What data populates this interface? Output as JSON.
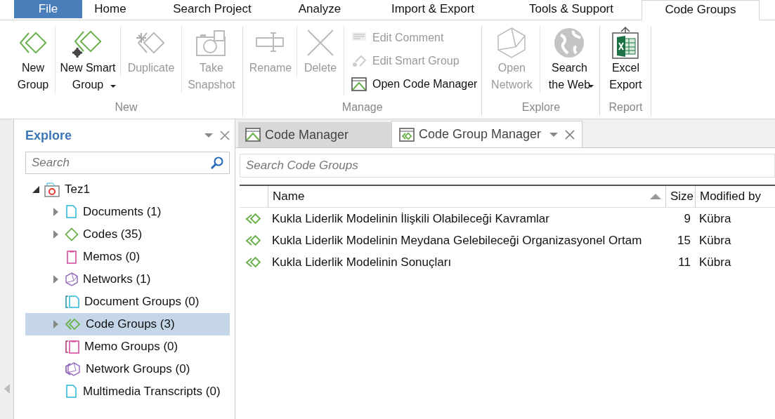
{
  "menu_tabs": [
    {
      "label": "File",
      "kind": "file",
      "selected": false
    },
    {
      "label": "Home",
      "kind": "tab",
      "selected": false
    },
    {
      "label": "Search Project",
      "kind": "tab",
      "selected": false
    },
    {
      "label": "Analyze",
      "kind": "tab",
      "selected": false
    },
    {
      "label": "Import & Export",
      "kind": "tab",
      "selected": false
    },
    {
      "label": "Tools & Support",
      "kind": "tab",
      "selected": false
    },
    {
      "label": "Code Groups",
      "kind": "tab",
      "selected": true
    }
  ],
  "ribbon": {
    "groups": [
      {
        "label": "New",
        "buttons": [
          {
            "kind": "large",
            "label": "New Group",
            "disabled": false,
            "dropdown": false
          },
          {
            "kind": "large",
            "label": "New Smart Group",
            "disabled": false,
            "dropdown": true
          },
          {
            "kind": "large",
            "label": "Duplicate",
            "disabled": true,
            "dropdown": false
          },
          {
            "kind": "large",
            "label": "Take Snapshot",
            "disabled": true,
            "dropdown": false
          }
        ]
      },
      {
        "label": "Manage",
        "buttons": [
          {
            "kind": "large",
            "label": "Rename",
            "disabled": true,
            "dropdown": false
          },
          {
            "kind": "large",
            "label": "Delete",
            "disabled": true,
            "dropdown": false
          },
          {
            "kind": "small",
            "label": "Edit Comment",
            "disabled": true
          },
          {
            "kind": "small",
            "label": "Edit Smart Group",
            "disabled": true
          },
          {
            "kind": "small",
            "label": "Open Code Manager",
            "disabled": false
          }
        ]
      },
      {
        "label": "Explore",
        "buttons": [
          {
            "kind": "large",
            "label": "Open Network",
            "disabled": true,
            "dropdown": false
          },
          {
            "kind": "large",
            "label": "Search the Web",
            "disabled": false,
            "dropdown": true
          }
        ]
      },
      {
        "label": "Report",
        "buttons": [
          {
            "kind": "large",
            "label": "Excel Export",
            "disabled": false,
            "dropdown": false
          }
        ]
      }
    ]
  },
  "explore": {
    "title": "Explore",
    "search": {
      "placeholder": "Search"
    },
    "tree": {
      "label": "Tez1",
      "expanded": true,
      "children": [
        {
          "label": "Documents (1)",
          "expanded": false,
          "selected": false
        },
        {
          "label": "Codes (35)",
          "expanded": false,
          "selected": false
        },
        {
          "label": "Memos (0)",
          "selected": false
        },
        {
          "label": "Networks (1)",
          "expanded": false,
          "selected": false
        },
        {
          "label": "Document Groups (0)",
          "selected": false
        },
        {
          "label": "Code Groups (3)",
          "expanded": false,
          "selected": true
        },
        {
          "label": "Memo Groups (0)",
          "selected": false
        },
        {
          "label": "Network Groups (0)",
          "selected": false
        },
        {
          "label": "Multimedia Transcripts (0)",
          "selected": false
        }
      ]
    }
  },
  "doc_tabs": [
    {
      "label": "Code Manager",
      "selected": false
    },
    {
      "label": "Code Group Manager",
      "selected": true
    }
  ],
  "code_groups": {
    "search": {
      "placeholder": "Search Code Groups"
    },
    "columns": [
      {
        "label": "Name",
        "sorted": true
      },
      {
        "label": "Size",
        "sorted": false
      },
      {
        "label": "Modified by",
        "sorted": false
      }
    ],
    "rows": [
      {
        "name": "Kukla Liderlik Modelinin İlişkili Olabileceği Kavramlar",
        "size": "9",
        "modified_by": "Kübra"
      },
      {
        "name": "Kukla Liderlik Modelinin Meydana Gelebileceği Organizasyonel Ortam",
        "size": "15",
        "modified_by": "Kübra"
      },
      {
        "name": "Kukla Liderlik Modelinin Sonuçları",
        "size": "11",
        "modified_by": "Kübra"
      }
    ]
  }
}
